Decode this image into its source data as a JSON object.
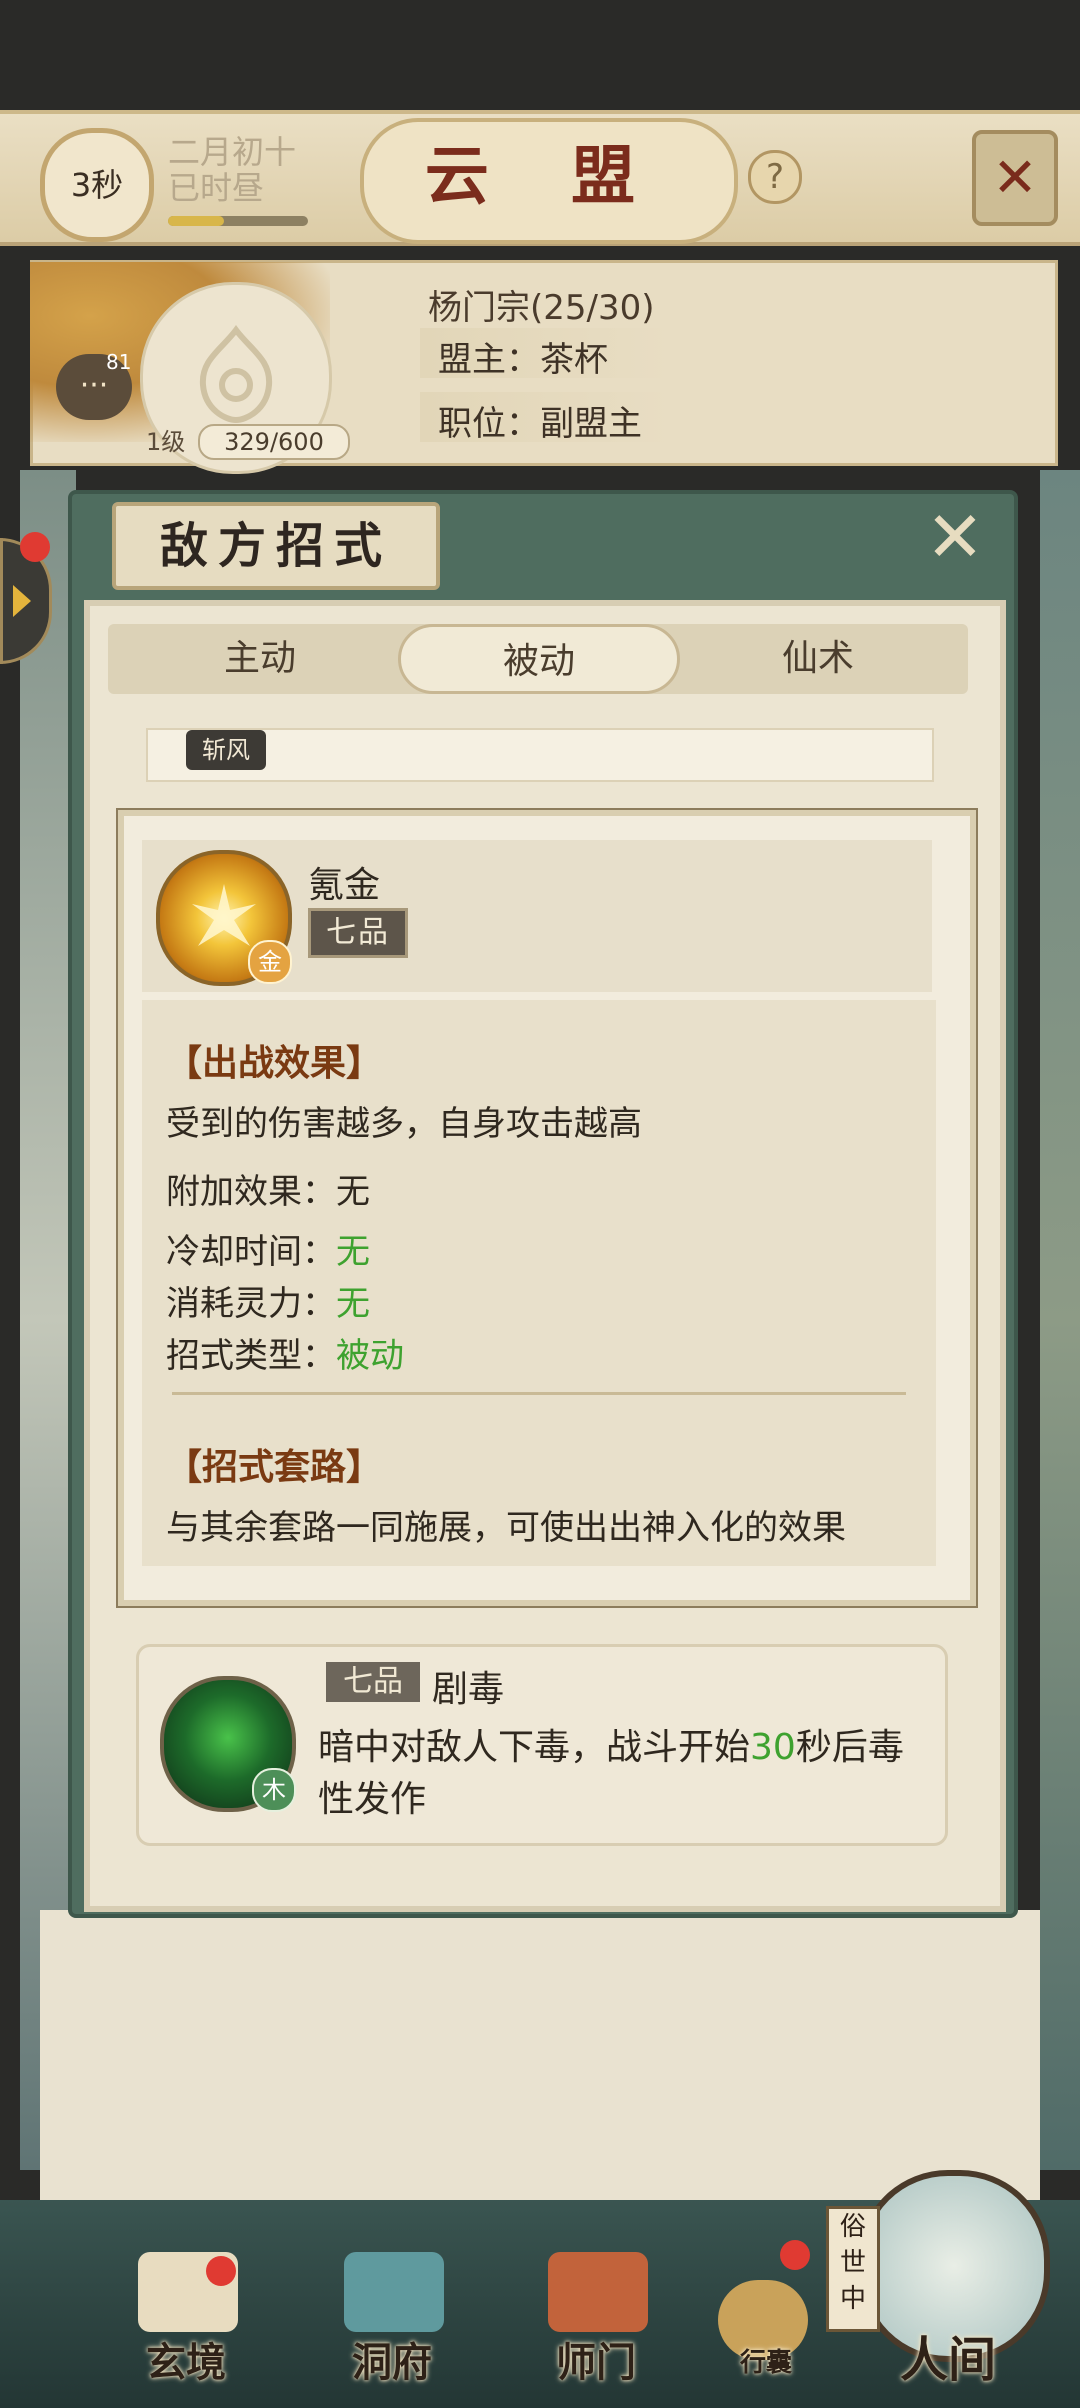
{
  "header": {
    "timer": "3秒",
    "date_line1": "二月初十",
    "date_line2": "已时昼",
    "title": "云 盟",
    "help_icon": "question-icon",
    "close_icon": "crossed-swords-icon"
  },
  "alliance": {
    "name": "杨门宗(25/30)",
    "leader": "盟主：茶杯",
    "position": "职位：副盟主",
    "level": "1级",
    "xp": "329/600",
    "chat_count": "81"
  },
  "panel": {
    "title": "敌方招式",
    "tabs": [
      "主动",
      "被动",
      "仙术"
    ],
    "active_tab": "被动",
    "partial_skill_tag": "斩风"
  },
  "popup": {
    "skill_name": "氪金",
    "grade": "七品",
    "element": "金",
    "section1_title": "【出战效果】",
    "effect": "受到的伤害越多，自身攻击越高",
    "extra_label": "附加效果：",
    "extra_value": "无",
    "cooldown_label": "冷却时间：",
    "cooldown_value": "无",
    "cost_label": "消耗灵力：",
    "cost_value": "无",
    "type_label": "招式类型：",
    "type_value": "被动",
    "section2_title": "【招式套路】",
    "combo_text": "与其余套路一同施展，可使出出神入化的效果"
  },
  "list_item": {
    "grade": "七品",
    "name": "剧毒",
    "element": "木",
    "desc_part1": "暗中对敌人下毒，战斗开始",
    "desc_highlight": "30",
    "desc_part2": "秒后毒性发作"
  },
  "bottom_nav": {
    "items": [
      "玄境",
      "洞府",
      "师门",
      "行囊",
      "人间"
    ],
    "world_tag": "俗世中"
  },
  "colors": {
    "accent_green": "#3ea22f",
    "title_red": "#7b2c1c",
    "section_brown": "#7a3a12"
  }
}
